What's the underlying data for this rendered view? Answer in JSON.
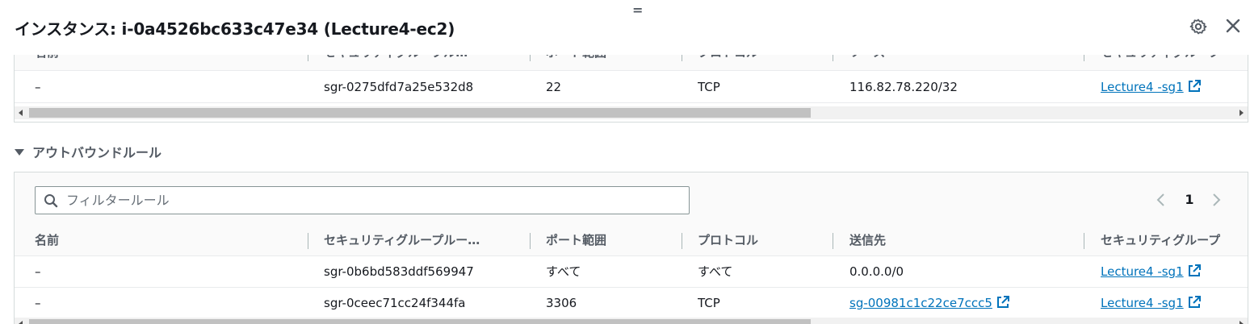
{
  "window": {
    "title": "インスタンス: i-0a4526bc633c47e34 (Lecture4-ec2)",
    "drag_handle": "="
  },
  "inbound": {
    "headers": [
      "名前",
      "セキュリティグループル…",
      "ポート範囲",
      "プロトコル",
      "ソース",
      "セキュリティグループ"
    ],
    "rows": [
      {
        "name": "–",
        "rule_id": "sgr-0275dfd7a25e532d8",
        "port": "22",
        "protocol": "TCP",
        "source": "116.82.78.220/32",
        "group": "Lecture4 -sg1"
      }
    ]
  },
  "outbound": {
    "section_label": "アウトバウンドルール",
    "filter_placeholder": "フィルタールール",
    "page": "1",
    "headers": [
      "名前",
      "セキュリティグループルー…",
      "ポート範囲",
      "プロトコル",
      "送信先",
      "セキュリティグループ"
    ],
    "rows": [
      {
        "name": "–",
        "rule_id": "sgr-0b6bd583ddf569947",
        "port": "すべて",
        "protocol": "すべて",
        "destination": "0.0.0.0/0",
        "group": "Lecture4 -sg1"
      },
      {
        "name": "–",
        "rule_id": "sgr-0ceec71cc24f344fa",
        "port": "3306",
        "protocol": "TCP",
        "destination": "sg-00981c1c22ce7ccc5",
        "group": "Lecture4 -sg1"
      }
    ]
  },
  "icons": {
    "settings": "gear-icon",
    "close": "close-icon",
    "external": "external-link-icon",
    "search": "search-icon"
  },
  "colors": {
    "link": "#0073bb",
    "text": "#16191f",
    "muted": "#545b64",
    "border": "#d5dbdb"
  }
}
